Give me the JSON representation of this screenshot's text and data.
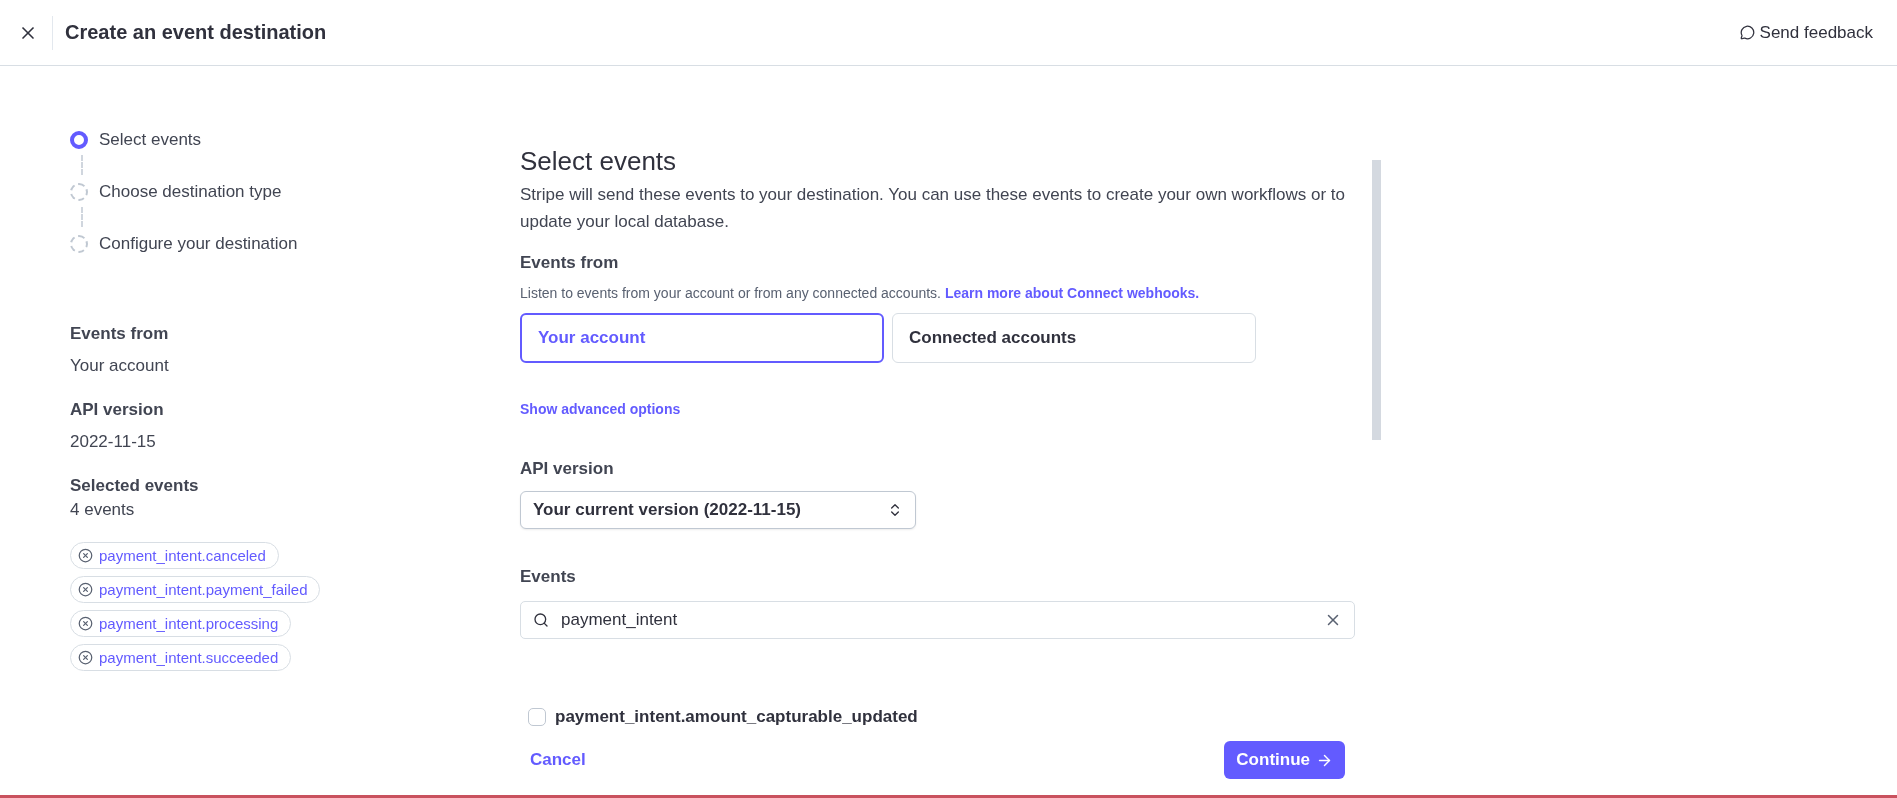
{
  "header": {
    "title": "Create an event destination",
    "feedback": "Send feedback"
  },
  "steps": [
    {
      "label": "Select events",
      "selected": true
    },
    {
      "label": "Choose destination type",
      "selected": false
    },
    {
      "label": "Configure your destination",
      "selected": false
    }
  ],
  "summary": [
    {
      "label": "Events from",
      "value": "Your account"
    },
    {
      "label": "API version",
      "value": "2022-11-15"
    },
    {
      "label": "Selected events",
      "value": "4 events"
    }
  ],
  "selected_events": [
    "payment_intent.canceled",
    "payment_intent.payment_failed",
    "payment_intent.processing",
    "payment_intent.succeeded"
  ],
  "main": {
    "title": "Select events",
    "description": "Stripe will send these events to your destination. You can use these events to create your own workflows or to update your local database.",
    "events_from": {
      "label": "Events from",
      "hint": "Listen to events from your account or from any connected accounts.",
      "link": "Learn more about Connect webhooks.",
      "options": [
        {
          "label": "Your account",
          "selected": true
        },
        {
          "label": "Connected accounts",
          "selected": false
        }
      ]
    },
    "advanced": "Show advanced options",
    "api_version": {
      "label": "API version",
      "value": "Your current version (2022-11-15)"
    },
    "events": {
      "label": "Events",
      "search": "payment_intent",
      "results": [
        {
          "label": "payment_intent.amount_capturable_updated",
          "checked": false
        }
      ]
    },
    "cancel": "Cancel",
    "continue": "Continue"
  }
}
